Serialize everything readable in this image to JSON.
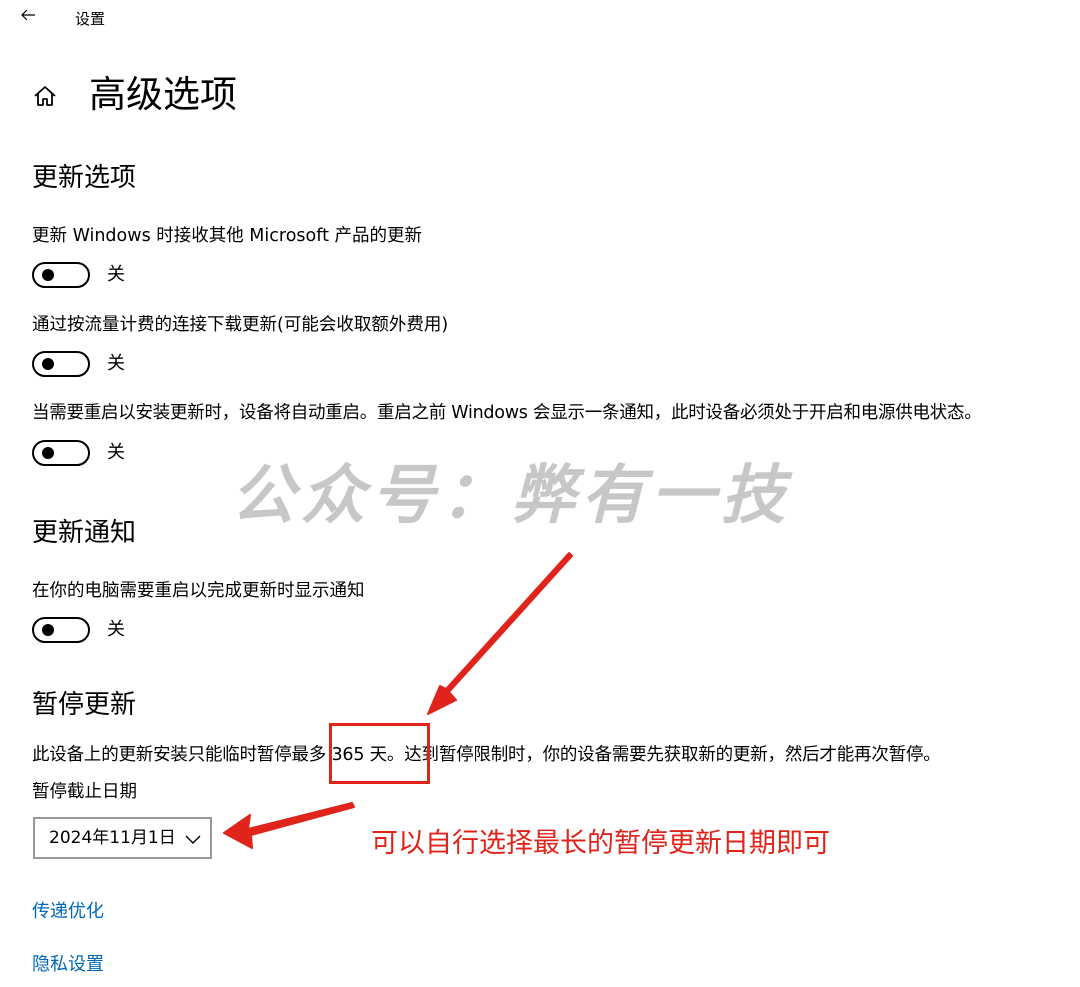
{
  "titlebar": {
    "app_name": "设置"
  },
  "page": {
    "title": "高级选项"
  },
  "update_options": {
    "heading": "更新选项",
    "settings": [
      {
        "label": "更新 Windows 时接收其他 Microsoft 产品的更新",
        "state": "关"
      },
      {
        "label": "通过按流量计费的连接下载更新(可能会收取额外费用)",
        "state": "关"
      },
      {
        "label": "当需要重启以安装更新时，设备将自动重启。重启之前 Windows 会显示一条通知，此时设备必须处于开启和电源供电状态。",
        "state": "关"
      }
    ]
  },
  "update_notifications": {
    "heading": "更新通知",
    "settings": [
      {
        "label": "在你的电脑需要重启以完成更新时显示通知",
        "state": "关"
      }
    ]
  },
  "pause_updates": {
    "heading": "暂停更新",
    "description": "此设备上的更新安装只能临时暂停最多 365 天。达到暂停限制时，你的设备需要先获取新的更新，然后才能再次暂停。",
    "date_label": "暂停截止日期",
    "date_value": "2024年11月1日"
  },
  "links": {
    "delivery_optimization": "传递优化",
    "privacy_settings": "隐私设置"
  },
  "overlay": {
    "watermark": "公众号：弊有一技",
    "annotation": "可以自行选择最长的暂停更新日期即可",
    "annotation_color": "#e0241b",
    "link_color": "#0067b8"
  }
}
